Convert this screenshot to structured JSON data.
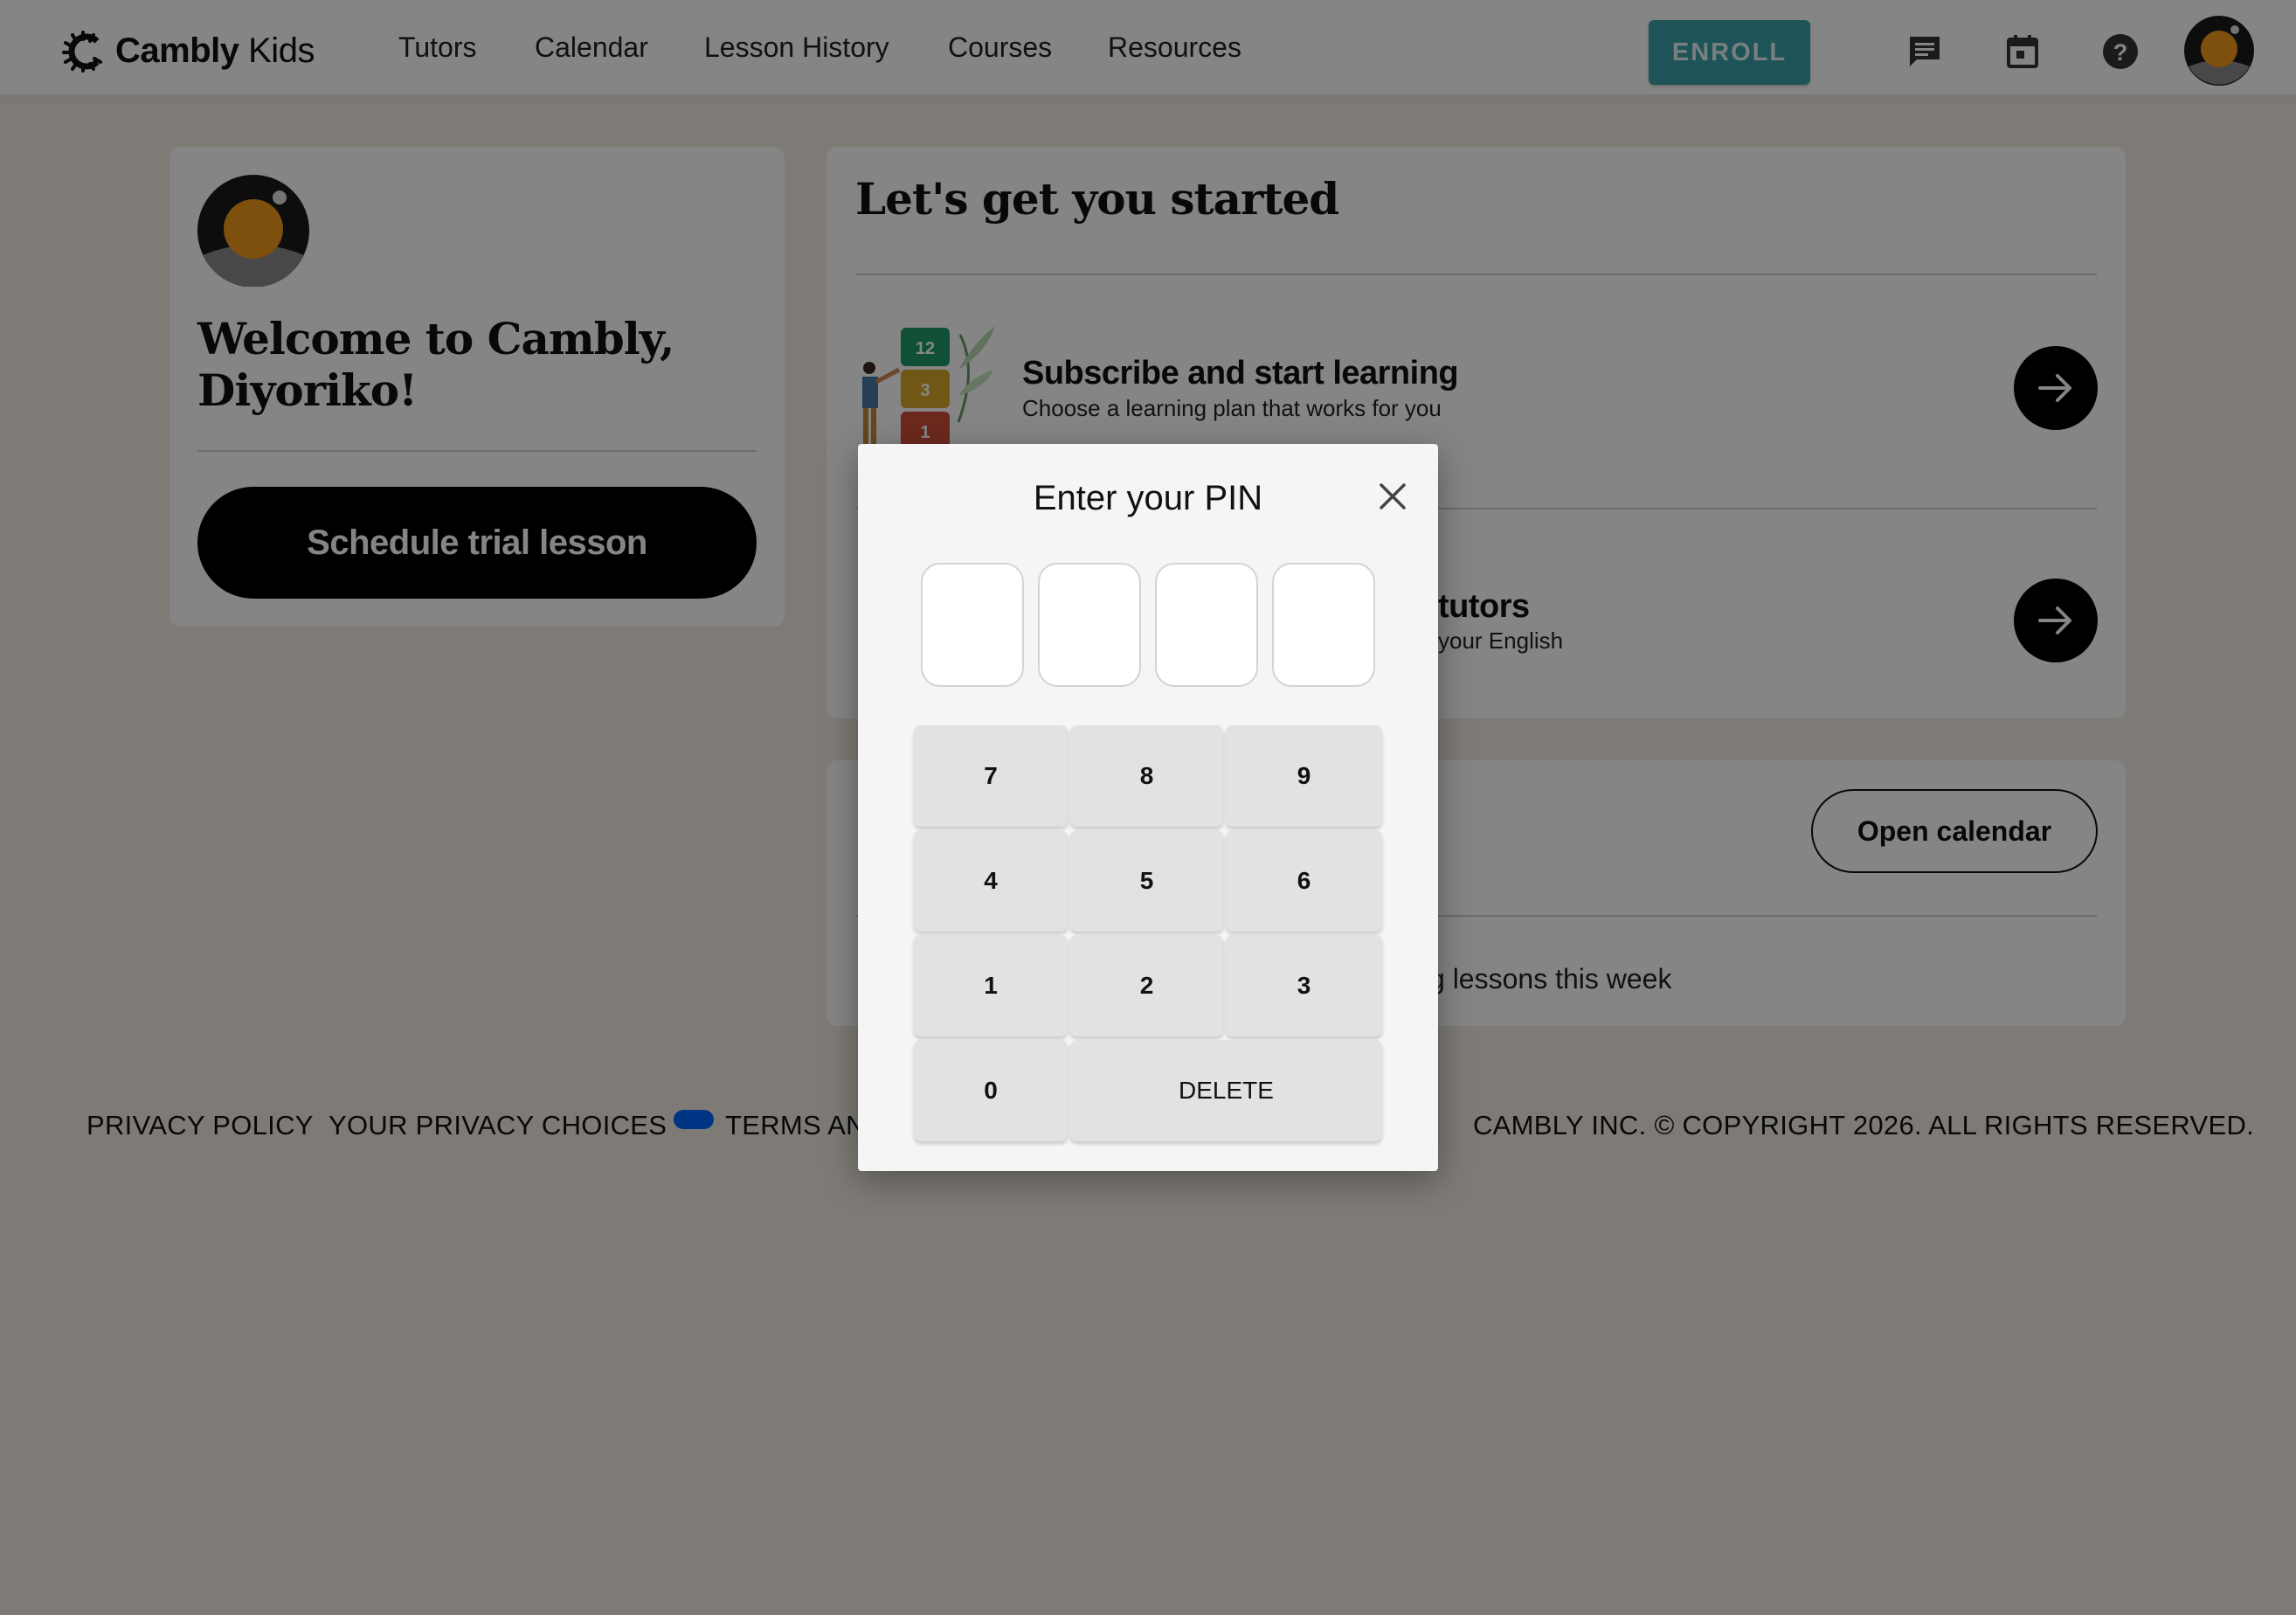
{
  "nav": {
    "logo_bold": "Cambly",
    "logo_light": "Kids",
    "links": [
      "Tutors",
      "Calendar",
      "Lesson History",
      "Courses",
      "Resources"
    ],
    "enroll_label": "ENROLL",
    "icons": [
      "chat-icon",
      "calendar-icon",
      "help-icon"
    ],
    "accent_color": "#3aa2a8"
  },
  "welcome": {
    "title": "Welcome to Cambly, Diyoriko!",
    "cta_label": "Schedule trial lesson"
  },
  "get_started": {
    "title": "Let's get you started",
    "rows": [
      {
        "title": "Subscribe and start learning",
        "subtitle": "Choose a learning plan that works for you",
        "illustration_numbers": [
          "12",
          "3",
          "1"
        ]
      },
      {
        "title": "tutors",
        "subtitle": "your English"
      }
    ]
  },
  "schedule": {
    "open_calendar_label": "Open calendar",
    "lessons_text": "g lessons this week"
  },
  "footer": {
    "privacy_policy": "PRIVACY POLICY",
    "privacy_choices": "YOUR PRIVACY CHOICES",
    "terms": "TERMS AN",
    "copyright": "CAMBLY INC. © COPYRIGHT 2026. ALL RIGHTS RESERVED."
  },
  "pin_modal": {
    "title": "Enter your PIN",
    "pin_digits": [
      "",
      "",
      "",
      ""
    ],
    "keys": [
      "7",
      "8",
      "9",
      "4",
      "5",
      "6",
      "1",
      "2",
      "3",
      "0"
    ],
    "delete_label": "DELETE"
  }
}
